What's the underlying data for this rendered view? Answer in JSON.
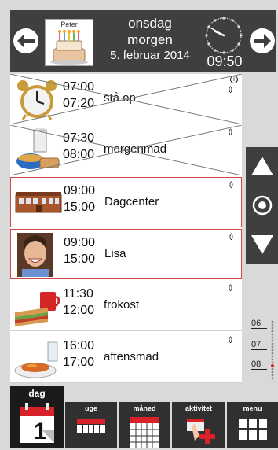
{
  "header": {
    "prev_icon": "arrow-left-icon",
    "next_icon": "arrow-right-icon",
    "person_name": "Peter",
    "weekday": "onsdag",
    "period": "morgen",
    "date": "5. februar 2014",
    "time": "09:50",
    "clock": {
      "hour": 9,
      "minute": 50
    }
  },
  "activities": [
    {
      "start": "07:00",
      "end": "07:20",
      "label": "stå op",
      "icon": "alarm-clock-icon",
      "done": true,
      "info": true
    },
    {
      "start": "07:30",
      "end": "08:00",
      "label": "morgenmad",
      "icon": "breakfast-icon",
      "done": true,
      "info": false
    },
    {
      "start": "09:00",
      "end": "15:00",
      "label": "Dagcenter",
      "icon": "daycenter-building-icon",
      "done": false,
      "current": true
    },
    {
      "start": "09:00",
      "end": "15:00",
      "label": "Lisa",
      "icon": "person-photo-icon",
      "done": false,
      "current": true
    },
    {
      "start": "11:30",
      "end": "12:00",
      "label": "frokost",
      "icon": "sandwich-icon",
      "done": false
    },
    {
      "start": "16:00",
      "end": "17:00",
      "label": "aftensmad",
      "icon": "dinner-plate-icon",
      "done": false
    }
  ],
  "side_controls": {
    "up_icon": "triangle-up-icon",
    "now_icon": "target-icon",
    "down_icon": "triangle-down-icon"
  },
  "week_scale": [
    "06",
    "07",
    "08"
  ],
  "tabs": [
    {
      "label": "dag",
      "icon": "day-calendar-icon",
      "active": true
    },
    {
      "label": "uge",
      "icon": "week-calendar-icon"
    },
    {
      "label": "måned",
      "icon": "month-calendar-icon"
    },
    {
      "label": "aktivitet",
      "icon": "add-activity-icon"
    },
    {
      "label": "menu",
      "icon": "menu-grid-icon"
    }
  ],
  "colors": {
    "header_bg": "#3f3f3f",
    "highlight_border": "#d04848",
    "calendar_red": "#d8222a"
  }
}
